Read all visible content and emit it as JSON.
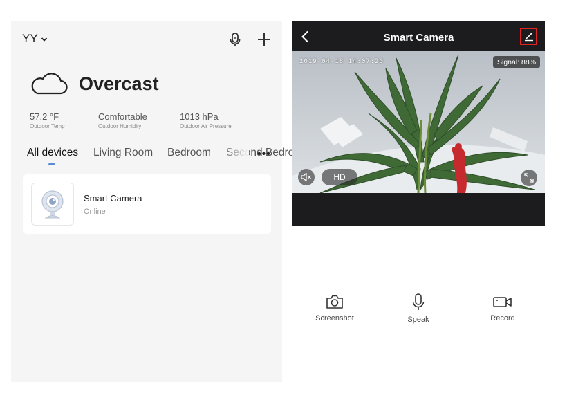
{
  "home": {
    "name": "YY"
  },
  "weather": {
    "condition": "Overcast",
    "stats": [
      {
        "value": "57.2 °F",
        "label": "Outdoor Temp"
      },
      {
        "value": "Comfortable",
        "label": "Outdoor Humidity"
      },
      {
        "value": "1013 hPa",
        "label": "Outdoor Air Pressure"
      }
    ]
  },
  "tabs": [
    {
      "label": "All devices",
      "active": true
    },
    {
      "label": "Living Room"
    },
    {
      "label": "Bedroom"
    },
    {
      "label": "Second Bedroom"
    }
  ],
  "devices": [
    {
      "name": "Smart Camera",
      "status": "Online",
      "icon": "camera-icon"
    }
  ],
  "camera": {
    "title": "Smart Camera",
    "timestamp": "2019-04-18 14:07:20",
    "signal": "Signal: 88%",
    "quality": "HD",
    "controls": [
      {
        "label": "Screenshot",
        "icon": "camera-icon"
      },
      {
        "label": "Speak",
        "icon": "microphone-icon"
      },
      {
        "label": "Record",
        "icon": "video-camera-icon"
      }
    ]
  },
  "colors": {
    "accent": "#5a8bd6",
    "highlight": "#e02424",
    "header_dark": "#1c1c1e"
  }
}
